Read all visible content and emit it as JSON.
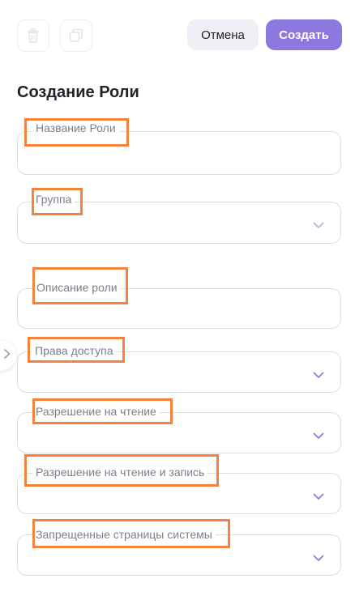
{
  "toolbar": {
    "delete_icon": "trash-icon",
    "copy_icon": "copy-icon",
    "cancel_label": "Отмена",
    "create_label": "Создать"
  },
  "form": {
    "title": "Создание Роли",
    "fields": [
      {
        "label": "Название Роли",
        "type": "text"
      },
      {
        "label": "Группа",
        "type": "select"
      },
      {
        "label": "Описание роли",
        "type": "text"
      },
      {
        "label": "Права доступа",
        "type": "select"
      },
      {
        "label": "Разрешение на чтение",
        "type": "select"
      },
      {
        "label": "Разрешение на чтение и запись",
        "type": "select"
      },
      {
        "label": "Запрещенные страницы системы",
        "type": "select"
      }
    ]
  },
  "colors": {
    "accent": "#8c78df",
    "highlight": "#f5833b",
    "chevron": "#8a7fd6"
  },
  "side_toggle_icon": "chevron-right-icon"
}
